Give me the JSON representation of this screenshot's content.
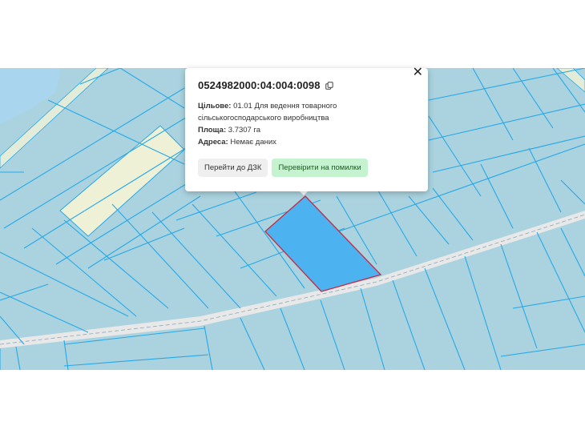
{
  "map": {
    "colors": {
      "parcel_fill": "#aad3df",
      "parcel_line": "#27a8e8",
      "selected_fill": "#4db3f0",
      "selected_border": "#c0304a",
      "other_parcel_fill": "#eef1d6",
      "water_fill": "#a9d6ee",
      "road_fill": "#e8e8e8"
    }
  },
  "popup": {
    "cadastral_number": "0524982000:04:004:0098",
    "purpose_label": "Цільове:",
    "purpose_value": "01.01 Для ведення товарного сільськогосподарського виробництва",
    "area_label": "Площа:",
    "area_value": "3.7307 га",
    "address_label": "Адреса:",
    "address_value": "Немає даних",
    "button_dzk": "Перейти до ДЗК",
    "button_check": "Перевірити на помилки",
    "close_icon": "close-icon",
    "copy_icon": "copy-icon"
  }
}
